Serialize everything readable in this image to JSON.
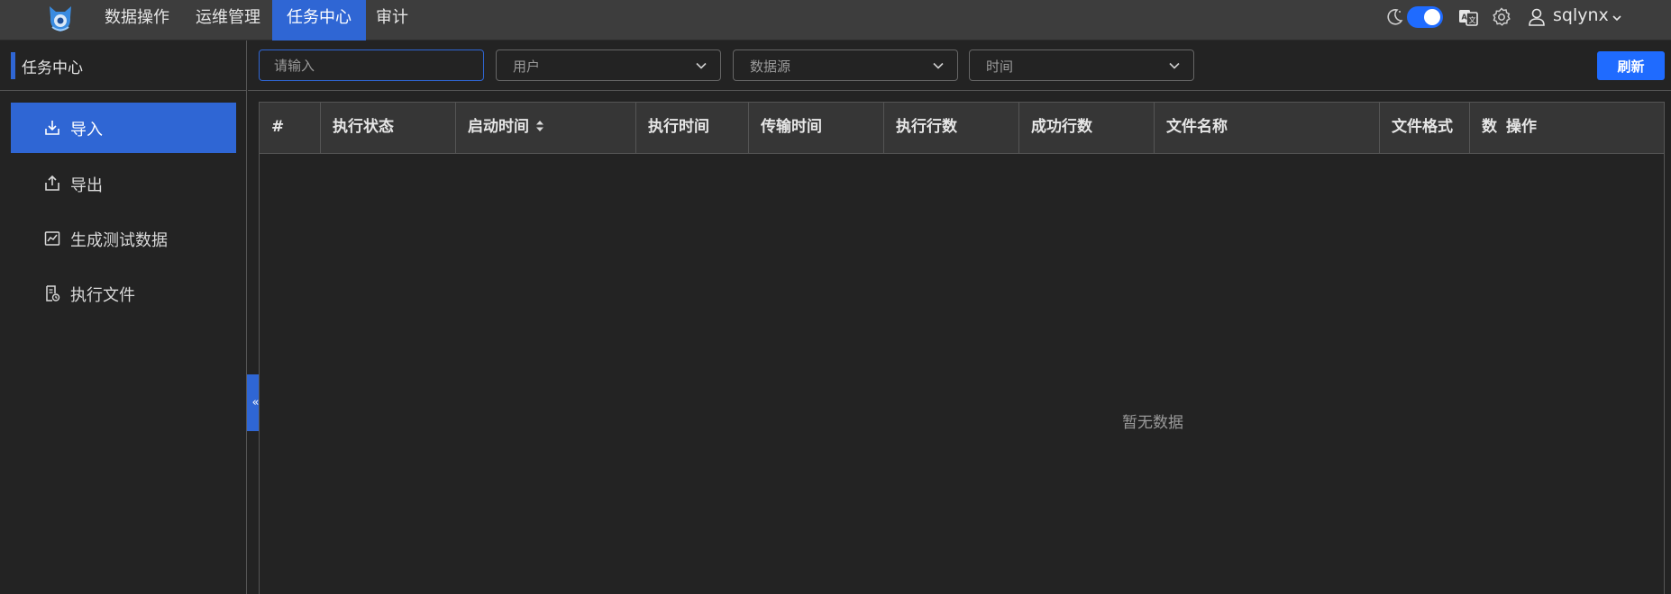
{
  "topnav": {
    "items": [
      {
        "label": "数据操作",
        "active": false
      },
      {
        "label": "运维管理",
        "active": false
      },
      {
        "label": "任务中心",
        "active": true
      },
      {
        "label": "审计",
        "active": false
      }
    ]
  },
  "topright": {
    "theme_toggle_on": true,
    "username": "sqlynx",
    "icons": [
      "moon-icon",
      "translate-icon",
      "gear-icon",
      "user-icon",
      "chevron-down-icon"
    ]
  },
  "sidebar": {
    "title": "任务中心",
    "items": [
      {
        "label": "导入",
        "icon": "import-icon",
        "active": true
      },
      {
        "label": "导出",
        "icon": "export-icon",
        "active": false
      },
      {
        "label": "生成测试数据",
        "icon": "chart-icon",
        "active": false
      },
      {
        "label": "执行文件",
        "icon": "file-icon",
        "active": false
      }
    ],
    "collapse_glyph": "«"
  },
  "filters": {
    "keyword_placeholder": "请输入",
    "user_placeholder": "用户",
    "datasource_placeholder": "数据源",
    "time_placeholder": "时间",
    "refresh_label": "刷新"
  },
  "table": {
    "columns": [
      "#",
      "执行状态",
      "启动时间",
      "执行时间",
      "传输时间",
      "执行行数",
      "成功行数",
      "文件名称",
      "文件格式",
      "数",
      "操作"
    ],
    "rows": [],
    "empty_text": "暂无数据"
  },
  "colors": {
    "accent": "#2f66d4",
    "primary_button": "#1f6bff",
    "background": "#232323",
    "topbar": "#3d3d3d"
  }
}
